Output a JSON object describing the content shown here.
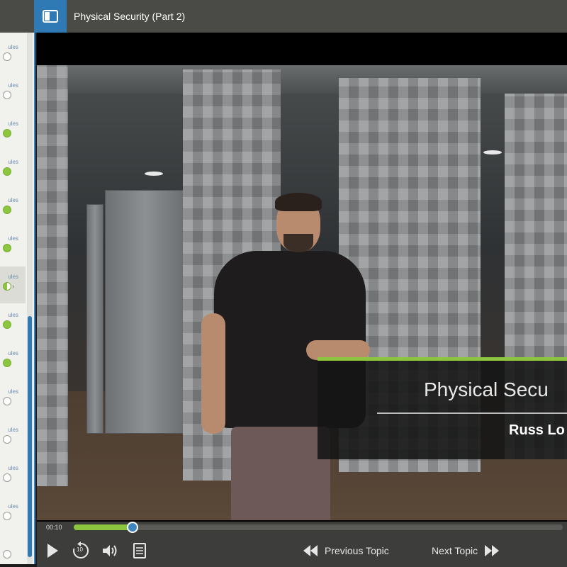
{
  "header": {
    "title": "Physical Security (Part 2)"
  },
  "sidebar": {
    "items": [
      {
        "label": "ules",
        "status": "incomplete"
      },
      {
        "label": "ules",
        "status": "incomplete"
      },
      {
        "label": "ules",
        "status": "complete"
      },
      {
        "label": "ules",
        "status": "complete"
      },
      {
        "label": "ules",
        "status": "complete"
      },
      {
        "label": "ules",
        "status": "complete"
      },
      {
        "label": "ules",
        "status": "in-progress",
        "active": true
      },
      {
        "label": "ules",
        "status": "complete"
      },
      {
        "label": "ules",
        "status": "complete"
      },
      {
        "label": "ules",
        "status": "incomplete"
      },
      {
        "label": "ules",
        "status": "incomplete"
      },
      {
        "label": "ules",
        "status": "incomplete"
      },
      {
        "label": "ules",
        "status": "incomplete"
      },
      {
        "label": "",
        "status": "incomplete"
      }
    ]
  },
  "video": {
    "lower_third_title": "Physical Secu",
    "lower_third_presenter": "Russ Lo"
  },
  "controls": {
    "time": "00:10",
    "progress": 0.12,
    "previous_label": "Previous Topic",
    "next_label": "Next Topic",
    "replay_seconds": "10"
  },
  "colors": {
    "accent_green": "#8cc63f",
    "accent_blue": "#2f79b4",
    "topbar": "#4a4b46",
    "controlbar": "#3d3e3b"
  }
}
